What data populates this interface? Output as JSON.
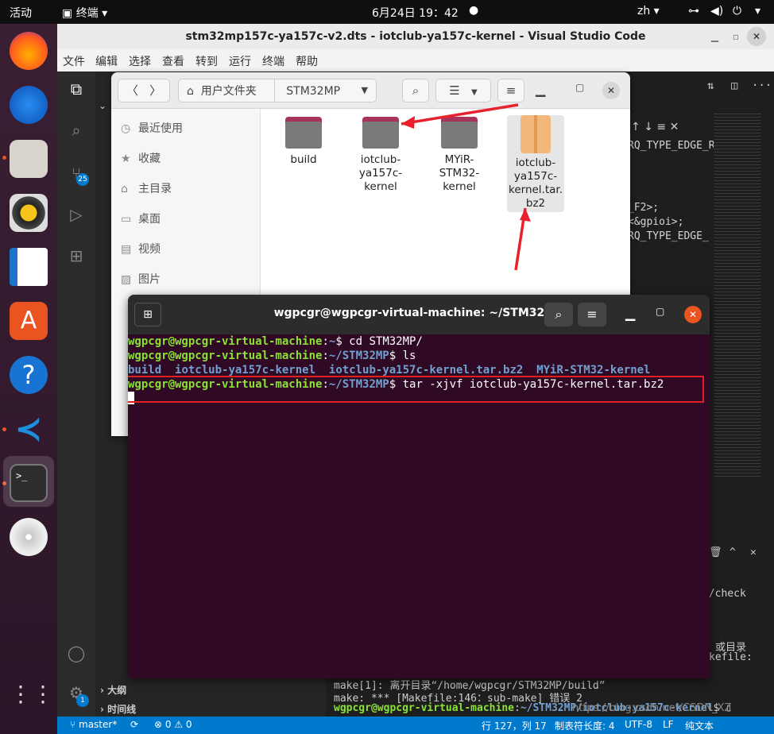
{
  "topbar": {
    "activities": "活动",
    "app": "终端",
    "clock": "6月24日  19：42",
    "lang": "zh"
  },
  "vscode": {
    "title": "stm32mp157c-ya157c-v2.dts - iotclub-ya157c-kernel - Visual Studio Code",
    "menu": [
      "文件",
      "编辑",
      "选择",
      "查看",
      "转到",
      "运行",
      "终端",
      "帮助"
    ],
    "scm_badge": "25",
    "account_badge": "1",
    "editor_lines": [
      "RQ_TYPE_EDGE_R",
      "_F2>;",
      "<&gpioi>;",
      "RQ_TYPE_EDGE_"
    ],
    "panel_lines": [
      "s/check",
      "或目录",
      "kefile:"
    ],
    "panel_bottom": [
      "make[1]: 离开目录“/home/wgpcgr/STM32MP/build”",
      "make: *** [Makefile:146：sub-make] 错误 2"
    ],
    "panel_prompt_user": "wgpcgr@wgpcgr-virtual-machine",
    "panel_prompt_path": "~/STM32MP/iotclub-ya157c-kernel",
    "outline": "大纲",
    "timeline": "时间线",
    "status": {
      "branch": "master*",
      "problems": "0",
      "warnings": "0",
      "position": "行 127，列 17",
      "tabsize": "制表符长度: 4",
      "encoding": "UTF-8",
      "eol": "LF",
      "lang": "纯文本"
    },
    "watermark": "https://blog.csdn.net/CSDN_XZ"
  },
  "files": {
    "breadcrumb": [
      "用户文件夹",
      "STM32MP"
    ],
    "places": [
      "最近使用",
      "收藏",
      "主目录",
      "桌面",
      "视频",
      "图片"
    ],
    "items": [
      {
        "name": "build",
        "kind": "folder"
      },
      {
        "name": "iotclub-ya157c-kernel",
        "kind": "folder"
      },
      {
        "name": "MYiR-STM32-kernel",
        "kind": "folder"
      },
      {
        "name": "iotclub-ya157c-kernel.tar.bz2",
        "kind": "archive"
      }
    ],
    "item_lines": [
      [
        "build"
      ],
      [
        "iotclub-",
        "ya157c-",
        "kernel"
      ],
      [
        "MYiR-",
        "STM32-",
        "kernel"
      ],
      [
        "iotclub-",
        "ya157c-",
        "kernel.tar.",
        "bz2"
      ]
    ]
  },
  "terminal": {
    "title": "wgpcgr@wgpcgr-virtual-machine: ~/STM32MP",
    "user": "wgpcgr@wgpcgr-virtual-machine",
    "lines": [
      {
        "path": "~",
        "cmd": "$ cd STM32MP/"
      },
      {
        "path": "~/STM32MP",
        "cmd": "$ ls"
      },
      {
        "path": "~/STM32MP",
        "cmd": "$ tar -xjvf iotclub-ya157c-kernel.tar.bz2"
      }
    ],
    "ls_output": [
      "build",
      "iotclub-ya157c-kernel",
      "iotclub-ya157c-kernel.tar.bz2",
      "MYiR-STM32-kernel"
    ]
  },
  "colors": {
    "dock": "#3a1f33",
    "terminal_bg": "#300a24",
    "prompt_green": "#8ae234",
    "prompt_blue": "#729fcf",
    "highlight": "#e0201f",
    "vscode_status": "#007acc"
  }
}
